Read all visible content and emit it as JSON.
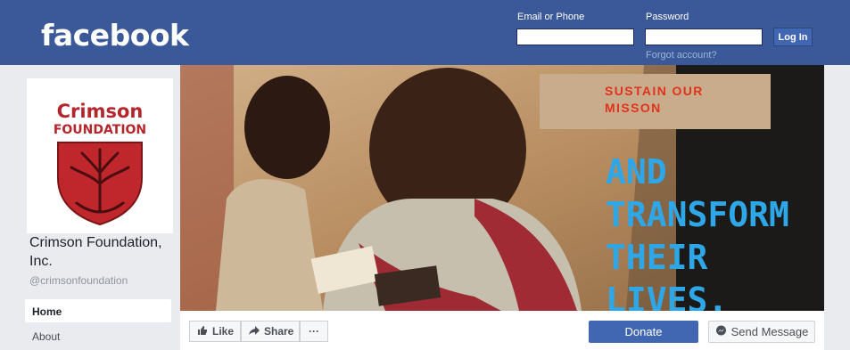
{
  "header": {
    "logo_text": "facebook",
    "email_label": "Email or Phone",
    "email_value": "",
    "password_label": "Password",
    "password_value": "",
    "login_button": "Log In",
    "forgot_link": "Forgot account?"
  },
  "page": {
    "logo_title_line1": "Crimson",
    "logo_title_line2": "FOUNDATION",
    "name": "Crimson Foundation, Inc.",
    "handle": "@crimsonfoundation",
    "nav": [
      {
        "label": "Home",
        "active": true
      },
      {
        "label": "About",
        "active": false
      }
    ]
  },
  "cover": {
    "headline": "SUSTAIN OUR MISSON",
    "slogan_line1": "AND",
    "slogan_line2": "TRANSFORM",
    "slogan_line3": "THEIR LIVES."
  },
  "actions": {
    "like": "Like",
    "share": "Share",
    "more": "···",
    "donate": "Donate",
    "send_message": "Send Message"
  },
  "colors": {
    "brand_blue": "#3b5998",
    "button_blue": "#4267b2",
    "crest_red": "#c0272d",
    "slogan_blue": "#2ea7e8",
    "headline_red": "#e0321c"
  },
  "icons": [
    "like-thumb-icon",
    "share-arrow-icon",
    "more-dots-icon",
    "messenger-icon",
    "tree-crest-icon"
  ]
}
